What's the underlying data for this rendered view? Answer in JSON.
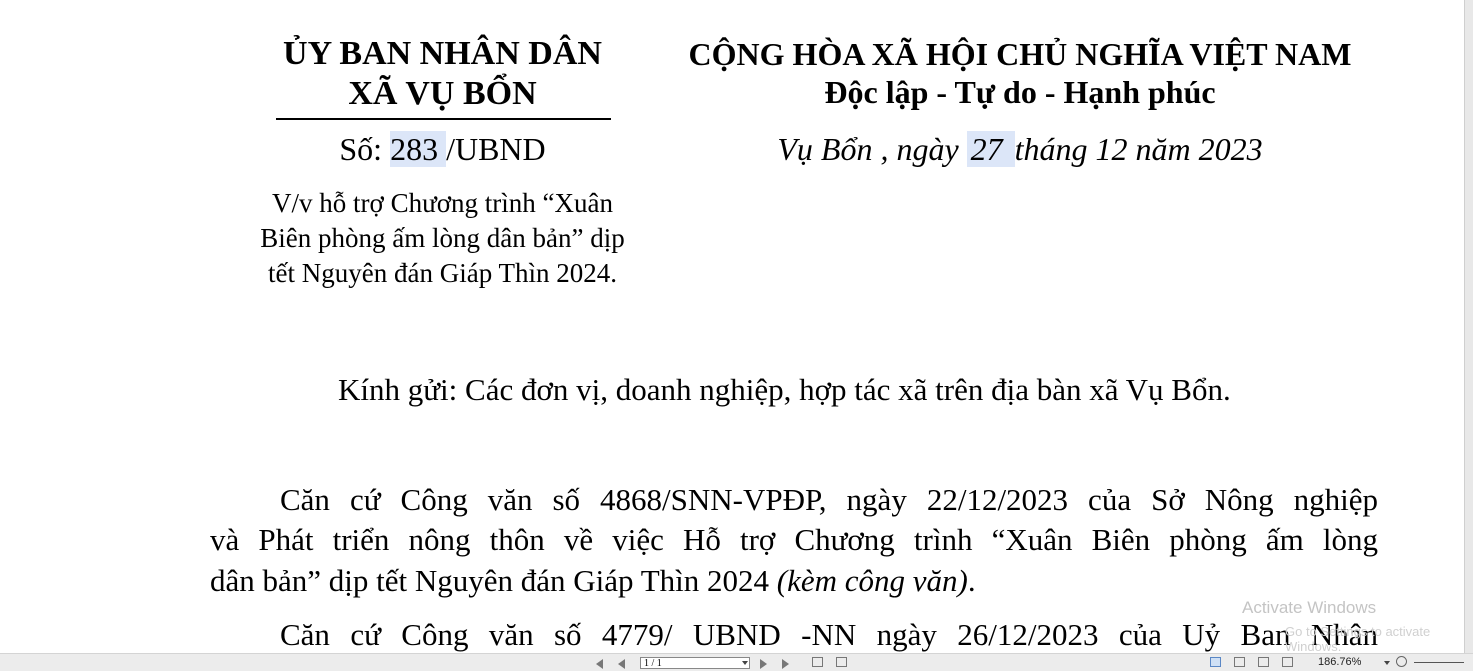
{
  "header_left": {
    "line1": "ỦY BAN NHÂN DÂN",
    "line2": "XÃ VỤ BỔN",
    "so_label": "Số: ",
    "so_number": "283 ",
    "so_suffix": "/UBND",
    "subject_line1": "V/v hỗ trợ Chương trình “Xuân",
    "subject_line2": "Biên phòng ấm lòng dân bản” dịp",
    "subject_line3": "tết Nguyên đán Giáp Thìn 2024."
  },
  "header_right": {
    "line1": "CỘNG HÒA XÃ HỘI CHỦ NGHĨA VIỆT NAM",
    "line2": "Độc lập - Tự do - Hạnh phúc",
    "date_prefix": "Vụ Bổn , ngày ",
    "date_day": "27 ",
    "date_suffix": " tháng 12  năm 2023"
  },
  "recipient": "Kính gửi: Các đơn vị, doanh nghiệp, hợp tác xã trên địa bàn xã Vụ Bổn.",
  "body": {
    "para1_line1": "Căn cứ Công văn số 4868/SNN-VPĐP, ngày 22/12/2023 của Sở Nông nghiệp",
    "para1_line2": "và Phát triển nông thôn về việc Hỗ trợ Chương trình “Xuân Biên phòng ấm lòng",
    "para1_line3_text": "dân bản” dịp tết Nguyên đán Giáp Thìn 2024 ",
    "para1_line3_italic": "(kèm công văn)",
    "para1_line3_end": ".",
    "para2_line1": "Căn cứ Công văn số 4779/ UBND -NN ngày 26/12/2023 của Uỷ Ban Nhân"
  },
  "watermark": {
    "line1": "Activate Windows",
    "line2": "Go to Settings to activate Windows."
  },
  "statusbar": {
    "page_value": "1 / 1",
    "zoom": "186.76%"
  }
}
